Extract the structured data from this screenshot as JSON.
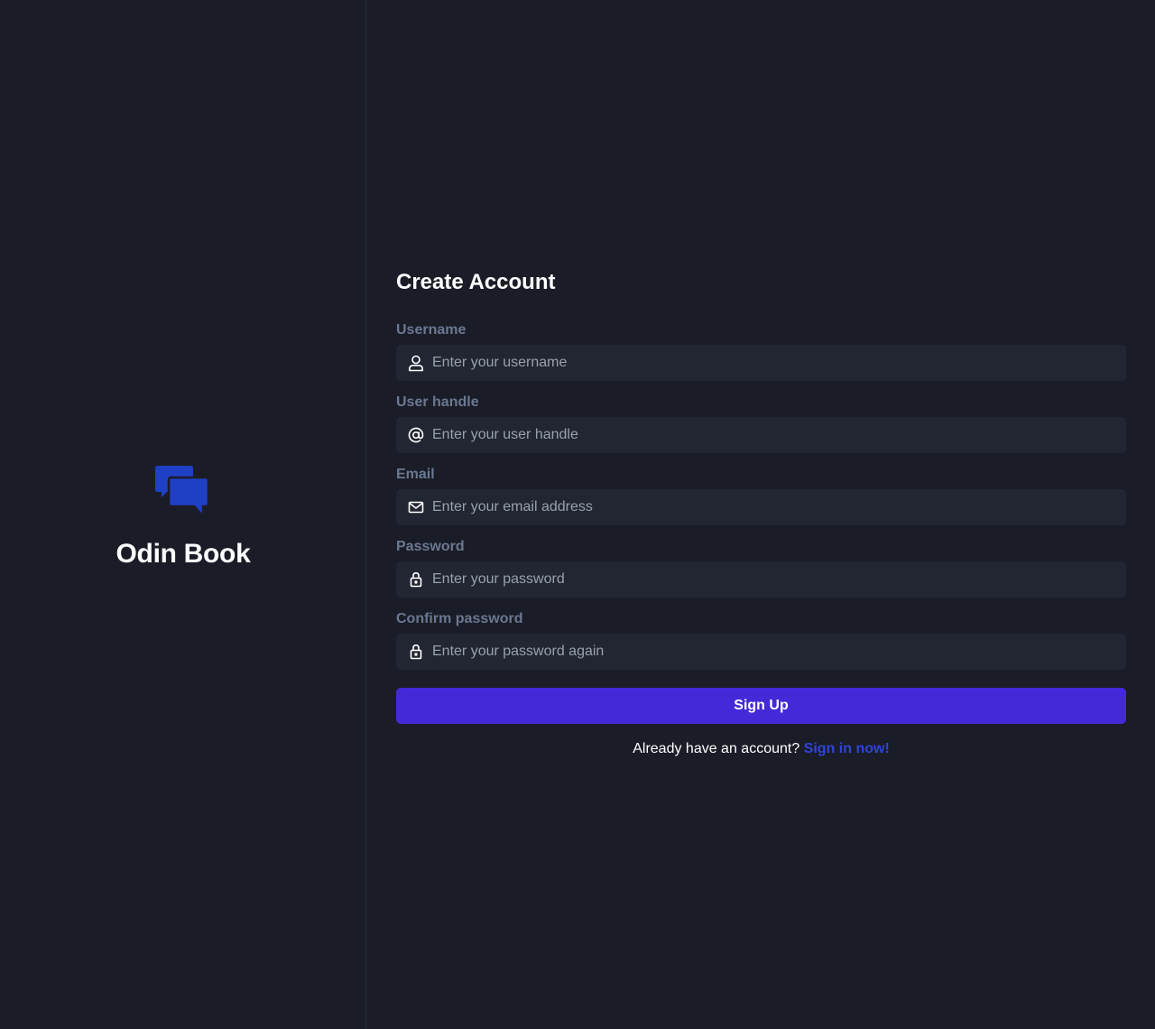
{
  "brand": {
    "name": "Odin Book",
    "logo_icon": "chat-bubbles-icon",
    "logo_color": "#1f3fc4"
  },
  "form": {
    "title": "Create Account",
    "fields": [
      {
        "label": "Username",
        "placeholder": "Enter your username",
        "value": "",
        "icon": "user-icon"
      },
      {
        "label": "User handle",
        "placeholder": "Enter your user handle",
        "value": "",
        "icon": "at-sign-icon"
      },
      {
        "label": "Email",
        "placeholder": "Enter your email address",
        "value": "",
        "icon": "mail-icon"
      },
      {
        "label": "Password",
        "placeholder": "Enter your password",
        "value": "",
        "icon": "lock-icon"
      },
      {
        "label": "Confirm password",
        "placeholder": "Enter your password again",
        "value": "",
        "icon": "lock-icon"
      }
    ],
    "submit_label": "Sign Up",
    "signin_prompt": "Already have an account?",
    "signin_link": "Sign in now!"
  },
  "colors": {
    "background": "#1a1d27",
    "input_background": "#222633",
    "label": "#6b7891",
    "accent_button": "#4329d8",
    "link": "#2f44d6"
  }
}
